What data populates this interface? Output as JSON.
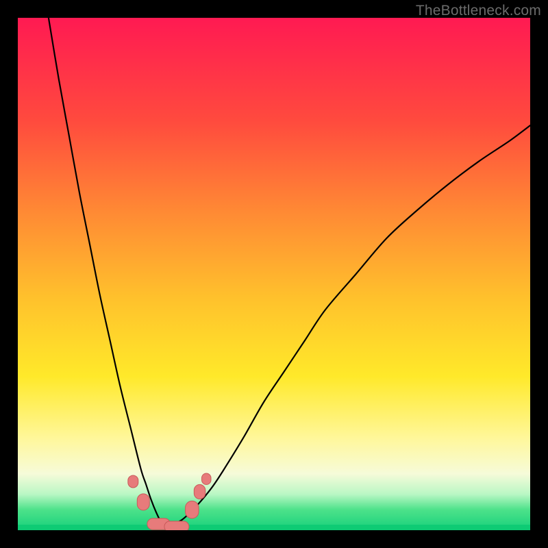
{
  "watermark": {
    "text": "TheBottleneck.com"
  },
  "colors": {
    "frame": "#000000",
    "gradient_top": "#ff1a52",
    "gradient_bottom": "#16d07b",
    "curve_stroke": "#000000",
    "marker_fill": "#e77b7b",
    "marker_stroke": "#c85a5a"
  },
  "chart_data": {
    "type": "line",
    "title": "",
    "xlabel": "",
    "ylabel": "",
    "xlim": [
      0,
      100
    ],
    "ylim": [
      0,
      100
    ],
    "grid": false,
    "legend": false,
    "note": "Background gradient encodes value band: red (high bottleneck) at top → green (no bottleneck) at bottom. Curve is a V-shaped dip touching the green band near x≈29.",
    "series": [
      {
        "name": "left-branch",
        "x": [
          6,
          8,
          10,
          12,
          14,
          16,
          18,
          20,
          22,
          24,
          25,
          26,
          27,
          28,
          29
        ],
        "y": [
          100,
          88,
          77,
          66,
          56,
          46,
          37,
          28,
          20,
          12,
          9,
          6,
          3.5,
          1.5,
          0.5
        ]
      },
      {
        "name": "right-branch",
        "x": [
          29,
          30,
          32,
          34,
          36,
          38,
          40,
          44,
          48,
          52,
          56,
          60,
          66,
          72,
          78,
          84,
          90,
          96,
          100
        ],
        "y": [
          0.5,
          1,
          2,
          3.8,
          6,
          8.5,
          11.5,
          18,
          25,
          31,
          37,
          43,
          50,
          57,
          62.5,
          67.5,
          72,
          76,
          79
        ]
      }
    ],
    "markers": {
      "name": "highlighted-points",
      "shape": "rounded-pill",
      "points": [
        {
          "x": 22.5,
          "y": 9.5,
          "w": 2.0,
          "h": 2.4
        },
        {
          "x": 24.5,
          "y": 5.5,
          "w": 2.4,
          "h": 3.2
        },
        {
          "x": 27.5,
          "y": 1.2,
          "w": 4.5,
          "h": 2.2
        },
        {
          "x": 31.0,
          "y": 0.7,
          "w": 4.8,
          "h": 2.1
        },
        {
          "x": 34.0,
          "y": 4.0,
          "w": 2.6,
          "h": 3.4
        },
        {
          "x": 35.5,
          "y": 7.5,
          "w": 2.2,
          "h": 2.8
        },
        {
          "x": 36.8,
          "y": 10.0,
          "w": 1.8,
          "h": 2.2
        }
      ]
    }
  }
}
